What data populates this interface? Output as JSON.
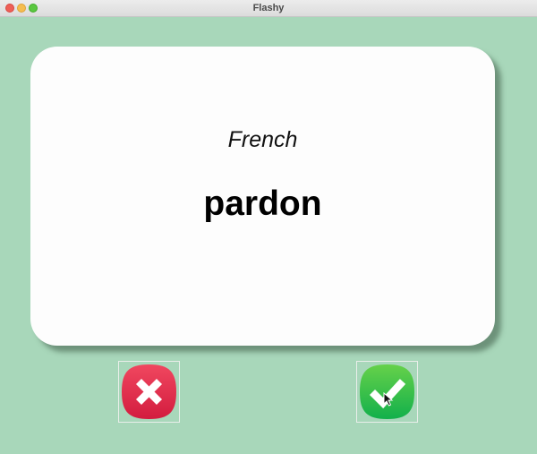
{
  "window": {
    "title": "Flashy"
  },
  "card": {
    "language": "French",
    "word": "pardon"
  },
  "buttons": {
    "wrong": {
      "icon": "x-mark-icon",
      "color": "#e0284a"
    },
    "right": {
      "icon": "check-mark-icon",
      "color": "#2fbf4a"
    }
  },
  "colors": {
    "background": "#a8d7ba",
    "card": "#fdfdfd"
  }
}
